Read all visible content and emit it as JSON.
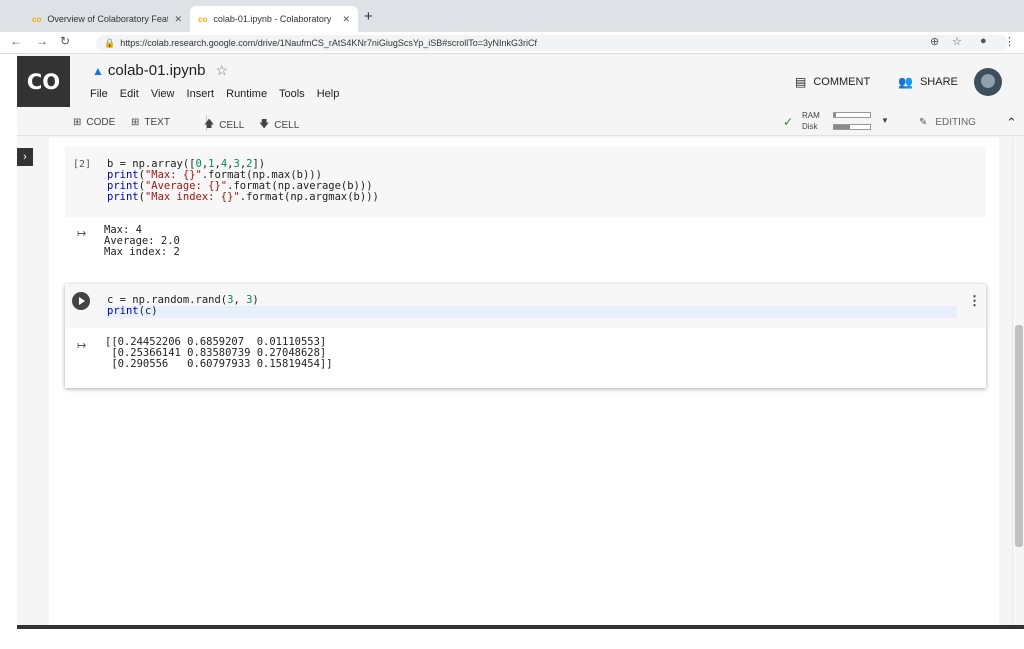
{
  "browser": {
    "tabs": [
      {
        "label": "Overview of Colaboratory Feat",
        "icon": "colab-tab-icon"
      },
      {
        "label": "colab-01.ipynb - Colaboratory",
        "icon": "colab-tab-icon"
      }
    ],
    "url": "https://colab.research.google.com/drive/1NaufmCS_rAtS4KNr7niGiugScsYp_iSB#scrollTo=3yNInkG3riCf"
  },
  "header": {
    "logo": "CO",
    "title": "colab-01.ipynb",
    "menu": [
      "File",
      "Edit",
      "View",
      "Insert",
      "Runtime",
      "Tools",
      "Help"
    ],
    "comment_label": "COMMENT",
    "share_label": "SHARE"
  },
  "toolbar": {
    "code_label": "CODE",
    "text_label": "TEXT",
    "cell_up_label": "CELL",
    "cell_down_label": "CELL",
    "ram_label": "RAM",
    "disk_label": "Disk",
    "ram_usage": 0.05,
    "disk_usage": 0.45,
    "editing_label": "EDITING"
  },
  "cells": [
    {
      "exec_count": "[2]",
      "output": "Max: 4\nAverage: 2.0\nMax index: 2"
    },
    {
      "output": "[[0.24452206 0.6859207  0.01110553]\n [0.25366141 0.83580739 0.27048628]\n [0.290556   0.60797933 0.15819454]]"
    }
  ],
  "colors": {
    "accent": "#1a73e8",
    "logo_bg": "#333333",
    "string": "#a31515",
    "number": "#098658"
  }
}
